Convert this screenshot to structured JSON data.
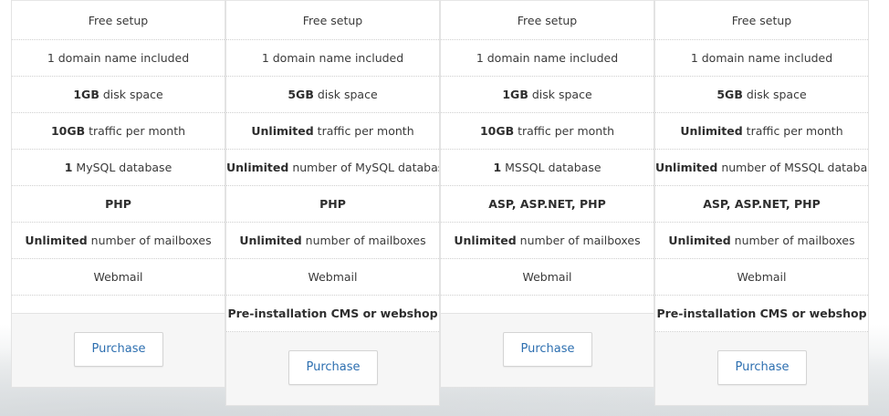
{
  "plans": [
    {
      "features": [
        {
          "bold": "",
          "text": "Free setup"
        },
        {
          "bold": "",
          "text": "1 domain name included"
        },
        {
          "bold": "1GB",
          "text": " disk space"
        },
        {
          "bold": "10GB",
          "text": " traffic per month"
        },
        {
          "bold": "1",
          "text": " MySQL database"
        },
        {
          "bold": "PHP",
          "text": ""
        },
        {
          "bold": "Unlimited",
          "text": " number of mailboxes"
        },
        {
          "bold": "",
          "text": "Webmail"
        }
      ],
      "extra": null,
      "purchase_label": "Purchase"
    },
    {
      "features": [
        {
          "bold": "",
          "text": "Free setup"
        },
        {
          "bold": "",
          "text": "1 domain name included"
        },
        {
          "bold": "5GB",
          "text": " disk space"
        },
        {
          "bold": "Unlimited",
          "text": " traffic per month"
        },
        {
          "bold": "Unlimited",
          "text": " number of MySQL databases"
        },
        {
          "bold": "PHP",
          "text": ""
        },
        {
          "bold": "Unlimited",
          "text": " number of mailboxes"
        },
        {
          "bold": "",
          "text": "Webmail"
        }
      ],
      "extra": "Pre-installation CMS or webshop",
      "purchase_label": "Purchase"
    },
    {
      "features": [
        {
          "bold": "",
          "text": "Free setup"
        },
        {
          "bold": "",
          "text": "1 domain name included"
        },
        {
          "bold": "1GB",
          "text": " disk space"
        },
        {
          "bold": "10GB",
          "text": " traffic per month"
        },
        {
          "bold": "1",
          "text": " MSSQL database"
        },
        {
          "bold": "ASP, ASP.NET, PHP",
          "text": ""
        },
        {
          "bold": "Unlimited",
          "text": " number of mailboxes"
        },
        {
          "bold": "",
          "text": "Webmail"
        }
      ],
      "extra": null,
      "purchase_label": "Purchase"
    },
    {
      "features": [
        {
          "bold": "",
          "text": "Free setup"
        },
        {
          "bold": "",
          "text": "1 domain name included"
        },
        {
          "bold": "5GB",
          "text": " disk space"
        },
        {
          "bold": "Unlimited",
          "text": " traffic per month"
        },
        {
          "bold": "Unlimited",
          "text": " number of MSSQL databases"
        },
        {
          "bold": "ASP, ASP.NET, PHP",
          "text": ""
        },
        {
          "bold": "Unlimited",
          "text": " number of mailboxes"
        },
        {
          "bold": "",
          "text": "Webmail"
        }
      ],
      "extra": "Pre-installation CMS or webshop",
      "purchase_label": "Purchase"
    }
  ]
}
